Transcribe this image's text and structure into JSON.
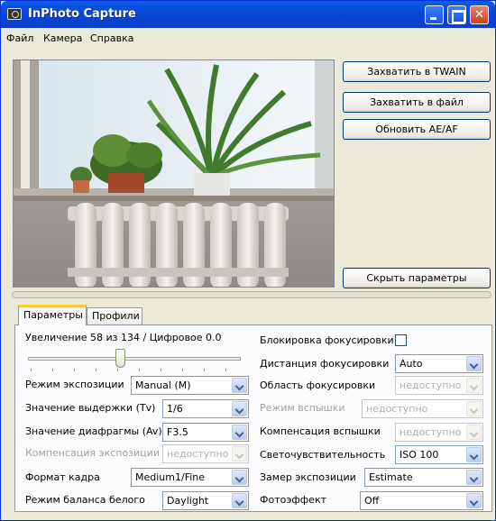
{
  "window": {
    "title": "InPhoto Capture"
  },
  "menu": [
    "Файл",
    "Камера",
    "Справка"
  ],
  "buttons": {
    "capture_twain": "Захватить в TWAIN",
    "capture_file": "Захватить в файл",
    "refresh_aeaf": "Обновить AE/AF",
    "hide_params": "Скрыть параметры"
  },
  "tabs": [
    "Параметры",
    "Профили"
  ],
  "zoom": {
    "text": "Увеличение 58 из 134 / Цифровое 0.0",
    "level": 0.43
  },
  "left": [
    {
      "label": "Режим экспозиции",
      "value": "Manual (M)",
      "enabled": true
    },
    {
      "label": "Значение выдержки (Tv)",
      "value": "1/6",
      "enabled": true
    },
    {
      "label": "Значение диафрагмы (Av)",
      "value": "F3.5",
      "enabled": true
    },
    {
      "label": "Компенсация экспозиции",
      "value": "недоступно",
      "enabled": false
    },
    {
      "label": "Формат кадра",
      "value": "Medium1/Fine",
      "enabled": true
    },
    {
      "label": "Режим баланса белого",
      "value": "Daylight",
      "enabled": true
    }
  ],
  "right": {
    "focus_lock": {
      "label": "Блокировка фокусировки",
      "checked": false
    },
    "rows": [
      {
        "label": "Дистанция фокусировки",
        "value": "Auto",
        "enabled": true
      },
      {
        "label": "Область фокусировки",
        "value": "недоступно",
        "enabled": false
      },
      {
        "label": "Режим вспышки",
        "value": "недоступно",
        "enabled": false
      },
      {
        "label": "Компенсация вспышки",
        "value": "недоступно",
        "enabled": false
      },
      {
        "label": "Светочувствительность",
        "value": "ISO 100",
        "enabled": true
      },
      {
        "label": "Замер экспозиции",
        "value": "Estimate",
        "enabled": true
      },
      {
        "label": "Фотоэффект",
        "value": "Off",
        "enabled": true
      }
    ]
  },
  "colors": {
    "titlebar": "#0a48d8",
    "window_bg": "#ece9d8",
    "tab_accent": "#ffc83c"
  },
  "icons": [
    "camera-app-icon",
    "minimize-icon",
    "maximize-icon",
    "close-icon",
    "chevron-down-icon"
  ]
}
